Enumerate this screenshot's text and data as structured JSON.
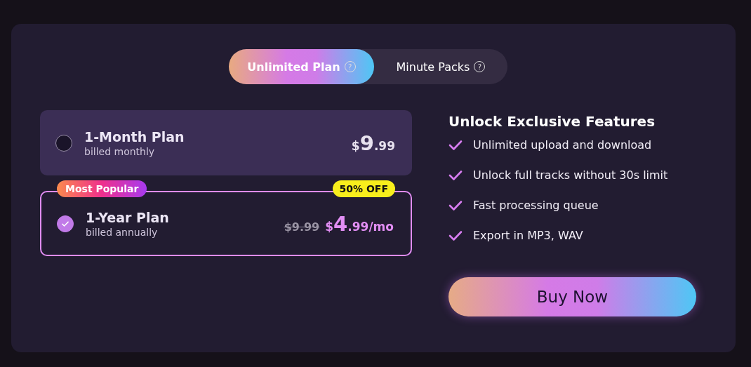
{
  "tabs": [
    {
      "label": "Unlimited Plan",
      "help": "?",
      "selected": true
    },
    {
      "label": "Minute Packs",
      "help": "?",
      "selected": false
    }
  ],
  "plans": [
    {
      "name": "1-Month Plan",
      "billing": "billed monthly",
      "currency": "$",
      "whole": "9",
      "cents": ".99",
      "selected": false
    },
    {
      "name": "1-Year Plan",
      "billing": "billed annually",
      "old_price": "$9.99",
      "currency": "$",
      "whole": "4",
      "cents": ".99/mo",
      "ribbon": "Most Popular",
      "discount": "50% OFF",
      "selected": true
    }
  ],
  "features": {
    "title": "Unlock Exclusive Features",
    "items": [
      "Unlimited upload and download",
      "Unlock full tracks without 30s limit",
      "Fast processing queue",
      "Export in MP3, WAV"
    ]
  },
  "buy_button": "Buy Now"
}
